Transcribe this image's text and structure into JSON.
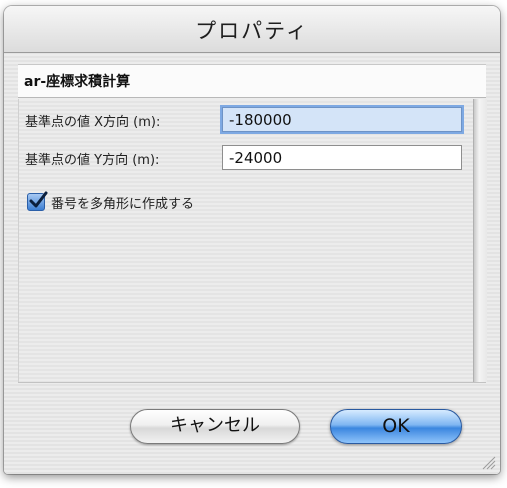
{
  "window": {
    "title": "プロパティ"
  },
  "section": {
    "title": "ar-座標求積計算"
  },
  "fields": [
    {
      "label": "基準点の値 X方向 (m):",
      "value": "-180000"
    },
    {
      "label": "基準点の値 Y方向 (m):",
      "value": "-24000"
    }
  ],
  "checkbox": {
    "label": "番号を多角形に作成する",
    "checked": true
  },
  "buttons": {
    "cancel_label": "キャンセル",
    "ok_label": "OK"
  },
  "colors": {
    "accent": "#3b86df",
    "focus": "#d4e4f8"
  }
}
